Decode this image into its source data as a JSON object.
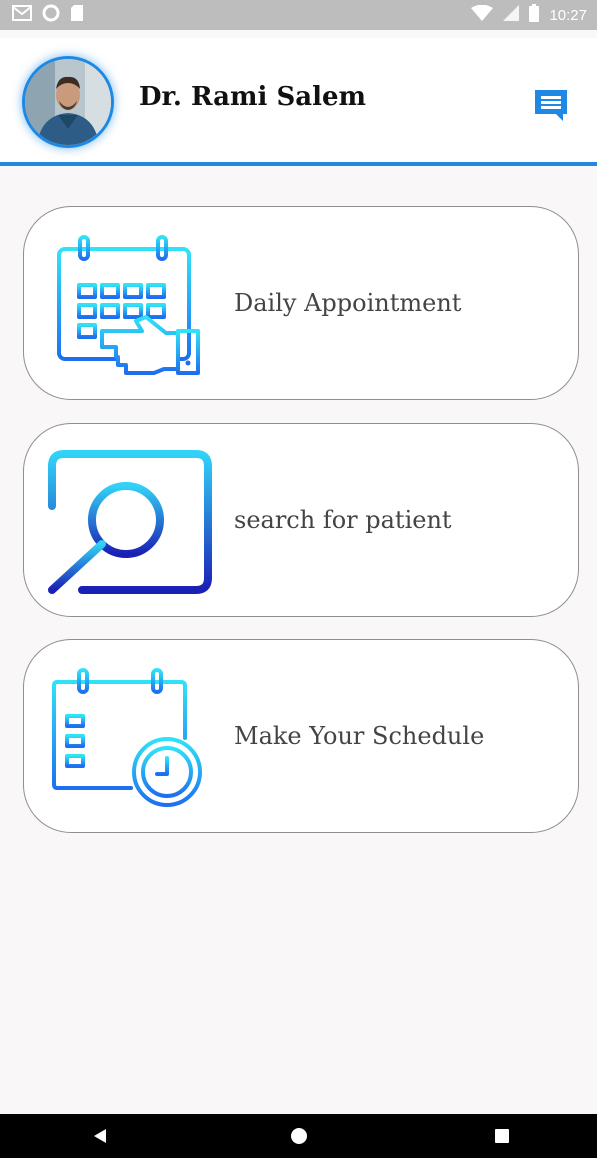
{
  "status_bar": {
    "time": "10:27",
    "left_icons": [
      "gmail-icon",
      "circle-notification-icon",
      "sd-card-icon"
    ],
    "right_icons": [
      "wifi-icon",
      "signal-icon",
      "battery-icon"
    ]
  },
  "header": {
    "doctor_name": "Dr. Rami Salem",
    "accent_color": "#2488e0",
    "message_icon": "message-icon"
  },
  "cards": [
    {
      "label": "Daily Appointment",
      "icon": "calendar-hand-icon"
    },
    {
      "label": "search for patient",
      "icon": "magnifier-icon"
    },
    {
      "label": "Make Your Schedule",
      "icon": "calendar-clock-icon"
    }
  ],
  "nav_bar": {
    "buttons": [
      "back-icon",
      "home-icon",
      "recents-icon"
    ]
  }
}
